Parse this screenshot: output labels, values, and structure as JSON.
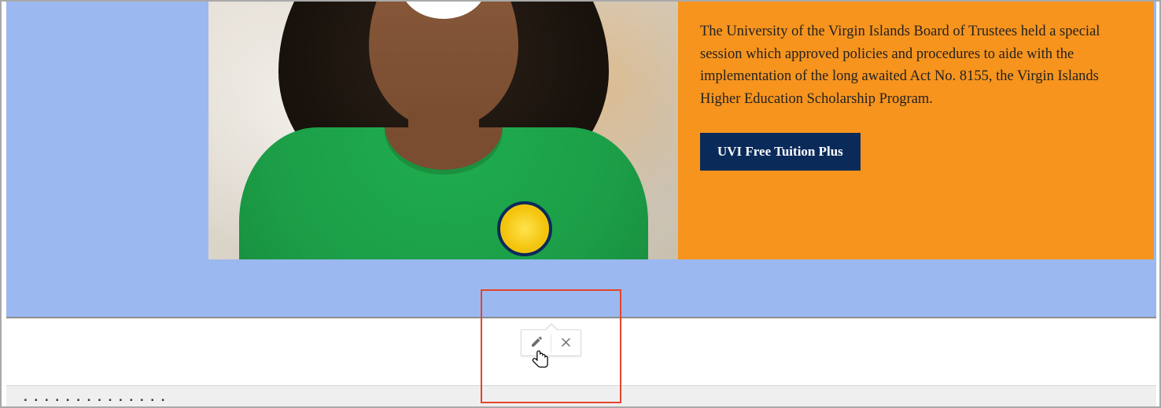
{
  "hero": {
    "body_text": "The University of the Virgin Islands Board of Trustees held a special session which approved policies and procedures to aide with the implementation of the long awaited Act No. 8155, the Virgin Islands Higher Education Scholarship Program.",
    "cta_label": "UVI Free Tuition Plus"
  },
  "bottom": {
    "partial_text": ". . . .  . .  . . .   .   .   . .   ."
  },
  "colors": {
    "band_blue": "#9bb8f0",
    "panel_orange": "#f7941d",
    "cta_navy": "#0a2a5a",
    "highlight_red": "#e4452a"
  }
}
